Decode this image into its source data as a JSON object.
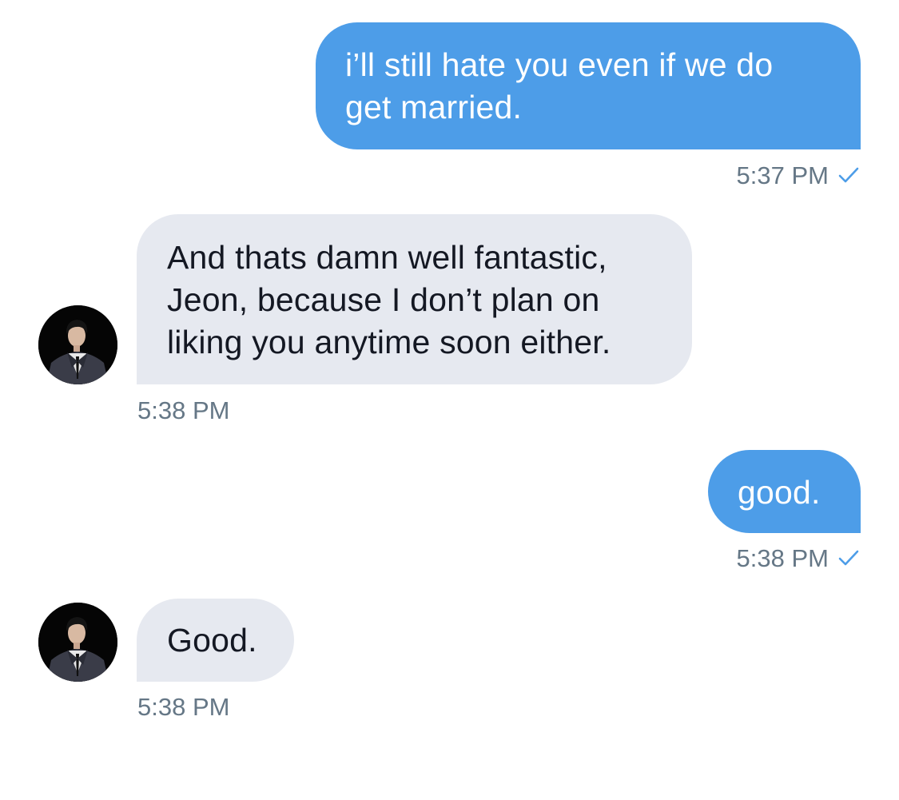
{
  "colors": {
    "sent_bubble": "#4d9de8",
    "received_bubble": "#e6e9f0",
    "timestamp": "#657786",
    "checkmark": "#4d9de8"
  },
  "messages": [
    {
      "direction": "sent",
      "lines": [
        "i’ll still hate you even if we do",
        "get married."
      ],
      "time": "5:37 PM",
      "status_icon": "check-icon"
    },
    {
      "direction": "received",
      "avatar_icon": "avatar",
      "lines": [
        "And thats damn well fantastic,",
        "Jeon, because I don’t plan on",
        "liking you anytime soon either."
      ],
      "time": "5:38 PM"
    },
    {
      "direction": "sent",
      "lines": [
        "good."
      ],
      "time": "5:38 PM",
      "status_icon": "check-icon"
    },
    {
      "direction": "received",
      "avatar_icon": "avatar",
      "lines": [
        "Good."
      ],
      "time": "5:38 PM"
    }
  ]
}
